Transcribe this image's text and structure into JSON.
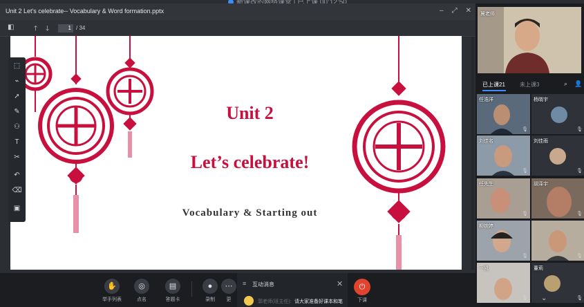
{
  "live_title": "新课改的网络课堂 | 已上课 00:12:50",
  "document": {
    "file_title": "Unit 2 Let's celebrate-- Vocabulary & Word formation.pptx",
    "current_page": "1",
    "total_pages": "/ 34"
  },
  "slide": {
    "unit": "Unit 2",
    "title": "Let’s celebrate!",
    "subtitle": "Vocabulary & Starting out",
    "accent_color": "#c8103e"
  },
  "bottom_bar": {
    "buttons": [
      {
        "label": "举手列表",
        "icon": "raise-hand-icon"
      },
      {
        "label": "点名",
        "icon": "roll-call-icon"
      },
      {
        "label": "答题卡",
        "icon": "answer-card-icon"
      },
      {
        "label": "录制",
        "icon": "record-icon"
      },
      {
        "label": "更",
        "icon": "more-icon"
      }
    ],
    "interaction": {
      "title": "互动消息",
      "sender": "郭老师(班主任):",
      "message": "请大家准备好课本和笔"
    },
    "end_label": "下课"
  },
  "right_panel": {
    "teacher_name": "冀老师",
    "tab_attended": "已上课21",
    "tab_absent": "未上课3",
    "students": [
      {
        "name": "任浩洋"
      },
      {
        "name": "杨晓宇"
      },
      {
        "name": "刘佳名"
      },
      {
        "name": "刘佳雨"
      },
      {
        "name": "任先生"
      },
      {
        "name": "胡泽宇"
      },
      {
        "name": "柳婉婷"
      },
      {
        "name": ""
      },
      {
        "name": "一凯"
      },
      {
        "name": "董莉"
      }
    ]
  }
}
